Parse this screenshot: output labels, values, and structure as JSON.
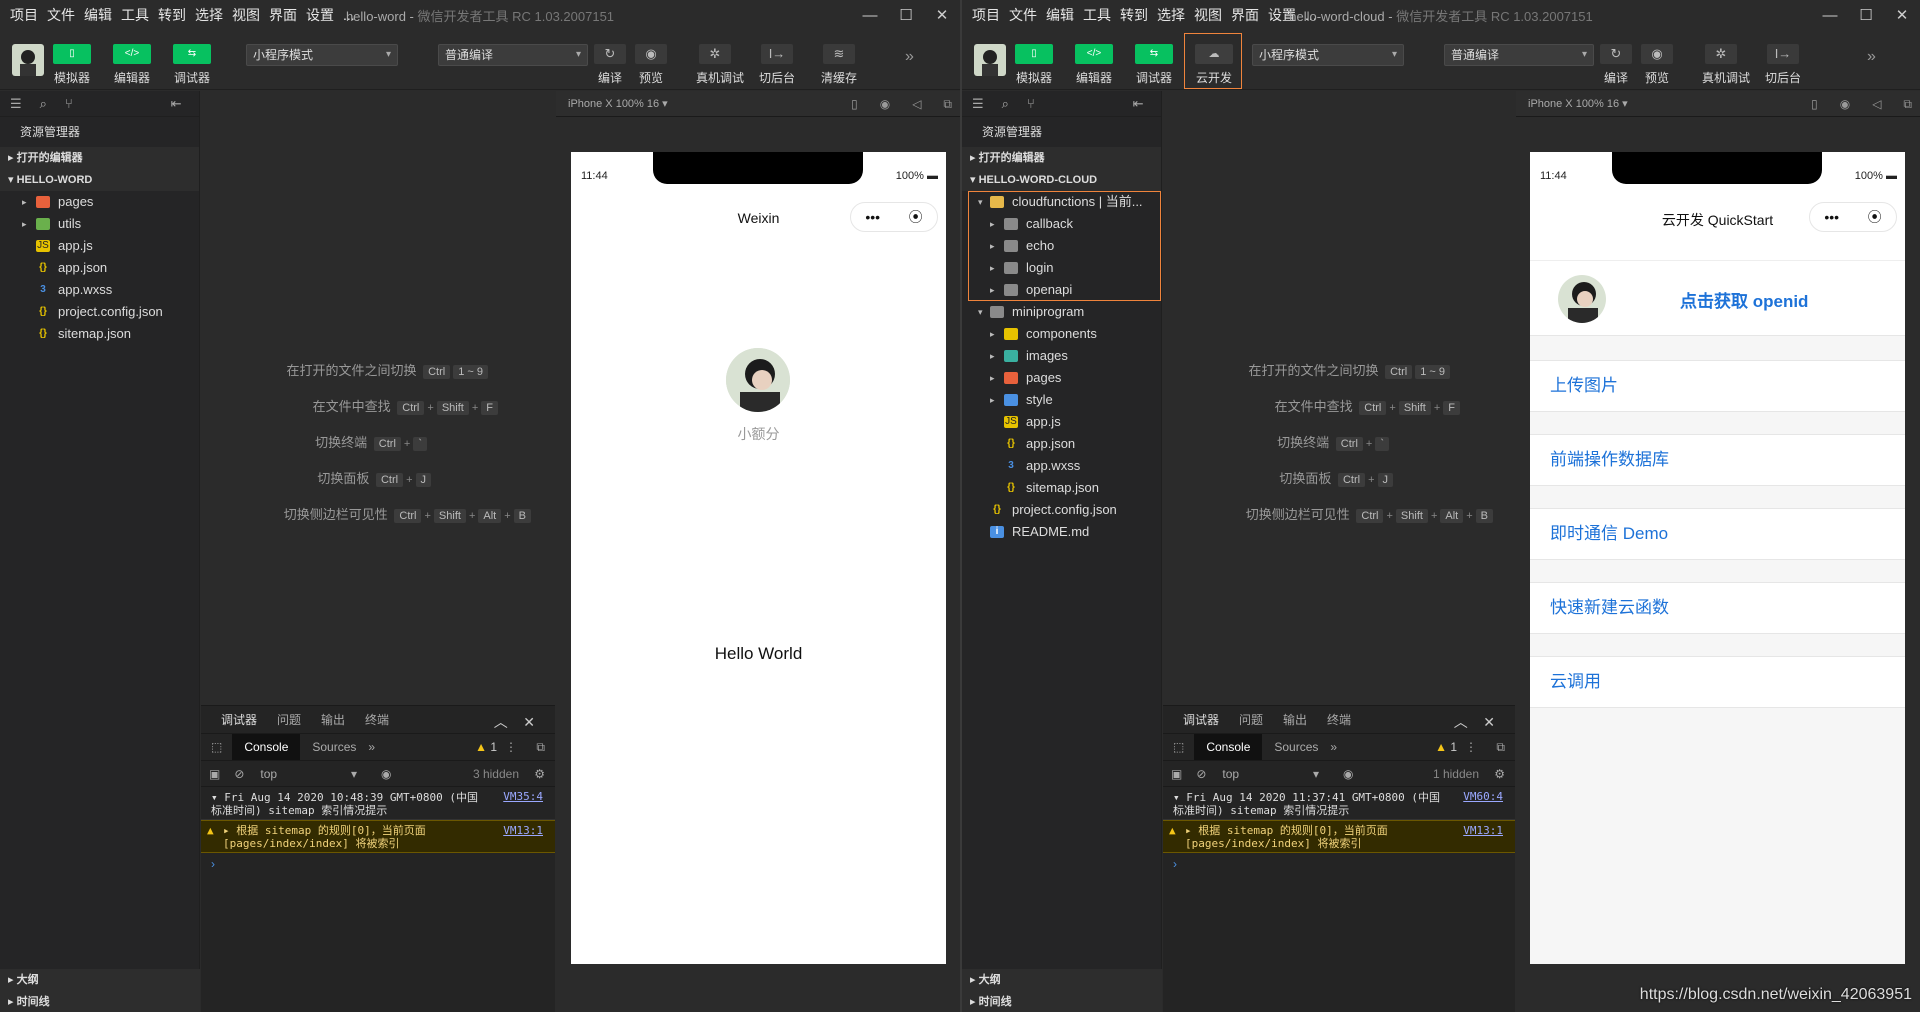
{
  "left": {
    "menu": [
      "项目",
      "文件",
      "编辑",
      "工具",
      "转到",
      "选择",
      "视图",
      "界面",
      "设置",
      "..."
    ],
    "title": "hello-word",
    "subtitle": "微信开发者工具 RC 1.03.2007151",
    "toolbar": {
      "simulator": "模拟器",
      "editor": "编辑器",
      "debugger": "调试器",
      "mode": "小程序模式",
      "compile_mode": "普通编译",
      "compile": "编译",
      "preview": "预览",
      "real_debug": "真机调试",
      "background": "切后台",
      "clear_cache": "清缓存"
    },
    "explorer": {
      "title": "资源管理器",
      "open_editors": "打开的编辑器",
      "project": "HELLO-WORD",
      "files": [
        "pages",
        "utils",
        "app.js",
        "app.json",
        "app.wxss",
        "project.config.json",
        "sitemap.json"
      ],
      "outline": "大纲",
      "timeline": "时间线"
    },
    "simulator": {
      "device": "iPhone X 100% 16 ▾",
      "time": "11:44",
      "battery": "100%",
      "nav_title": "Weixin",
      "nickname": "小额分",
      "hello": "Hello World"
    },
    "console": {
      "timestamp": "Fri Aug 14 2020 10:48:39 GMT+0800 (中国",
      "timestamp2": "标准时间) sitemap 索引情况提示",
      "src1": "VM35:4",
      "warn_line1": "▸ 根据 sitemap 的规则[0]，当前页面",
      "warn_line2": "[pages/index/index] 将被索引",
      "src2": "VM13:1",
      "hidden": "3 hidden",
      "warn_count": "1"
    }
  },
  "right": {
    "menu": [
      "项目",
      "文件",
      "编辑",
      "工具",
      "转到",
      "选择",
      "视图",
      "界面",
      "设置",
      "..."
    ],
    "title": "hello-word-cloud",
    "subtitle": "微信开发者工具 RC 1.03.2007151",
    "toolbar": {
      "simulator": "模拟器",
      "editor": "编辑器",
      "debugger": "调试器",
      "cloud": "云开发",
      "mode": "小程序模式",
      "compile_mode": "普通编译",
      "compile": "编译",
      "preview": "预览",
      "real_debug": "真机调试",
      "background": "切后台"
    },
    "explorer": {
      "title": "资源管理器",
      "open_editors": "打开的编辑器",
      "project": "HELLO-WORD-CLOUD",
      "cloudfunctions": "cloudfunctions | 当前...",
      "cloud_items": [
        "callback",
        "echo",
        "login",
        "openapi"
      ],
      "miniprogram": "miniprogram",
      "mini_items": [
        "components",
        "images",
        "pages",
        "style",
        "app.js",
        "app.json",
        "app.wxss",
        "sitemap.json"
      ],
      "root_files": [
        "project.config.json",
        "README.md"
      ],
      "outline": "大纲",
      "timeline": "时间线"
    },
    "simulator": {
      "device": "iPhone X 100% 16 ▾",
      "time": "11:44",
      "battery": "100%",
      "nav_title": "云开发 QuickStart",
      "openid": "点击获取 openid",
      "items": [
        "上传图片",
        "前端操作数据库",
        "即时通信 Demo",
        "快速新建云函数",
        "云调用"
      ]
    },
    "console": {
      "timestamp": "Fri Aug 14 2020 11:37:41 GMT+0800 (中国",
      "timestamp2": "标准时间) sitemap 索引情况提示",
      "src1": "VM60:4",
      "warn_line1": "▸ 根据 sitemap 的规则[0]，当前页面",
      "warn_line2": "[pages/index/index] 将被索引",
      "src2": "VM13:1",
      "hidden": "1 hidden",
      "warn_count": "1"
    }
  },
  "shortcuts": [
    {
      "label": "在打开的文件之间切换",
      "keys": [
        "Ctrl",
        "1 ~ 9"
      ]
    },
    {
      "label": "在文件中查找",
      "keys": [
        "Ctrl",
        "Shift",
        "F"
      ]
    },
    {
      "label": "切换终端",
      "keys": [
        "Ctrl",
        "`"
      ]
    },
    {
      "label": "切换面板",
      "keys": [
        "Ctrl",
        "J"
      ]
    },
    {
      "label": "切换侧边栏可见性",
      "keys": [
        "Ctrl",
        "Shift",
        "Alt",
        "B"
      ]
    }
  ],
  "debug_tabs": [
    "调试器",
    "问题",
    "输出",
    "终端"
  ],
  "console_tabs": [
    "Console",
    "Sources"
  ],
  "context": "top",
  "watermark": "https://blog.csdn.net/weixin_42063951",
  "colors": {
    "accent_green": "#07c160",
    "highlight": "#f0843c",
    "link_blue": "#1d72d8"
  }
}
